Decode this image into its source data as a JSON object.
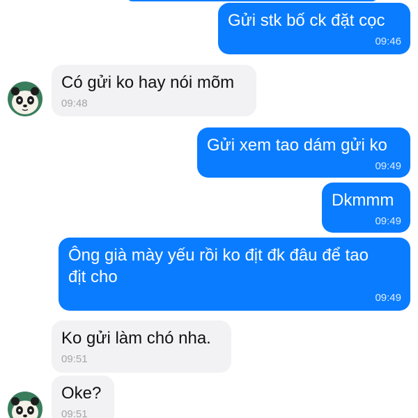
{
  "messages": [
    {
      "text": "Gửi stk bố ck đặt cọc",
      "time": "09:46",
      "direction": "outgoing"
    },
    {
      "text": "Có gửi ko hay nói mõm",
      "time": "09:48",
      "direction": "incoming"
    },
    {
      "text": "Gửi xem tao dám gửi ko",
      "time": "09:49",
      "direction": "outgoing"
    },
    {
      "text": "Dkmmm",
      "time": "09:49",
      "direction": "outgoing"
    },
    {
      "text": "Ông già mày yếu rồi ko địt đk đâu để tao\nđịt cho",
      "time": "09:49",
      "direction": "outgoing"
    },
    {
      "text": "Ko gửi làm chó nha.",
      "time": "09:51",
      "direction": "incoming"
    },
    {
      "text": "Oke?",
      "time": "09:51",
      "direction": "incoming"
    }
  ],
  "colors": {
    "outgoing_bubble": "#0a7cff",
    "incoming_bubble": "#f2f2f4"
  },
  "contact": {
    "avatar_icon": "panda-avatar-icon"
  }
}
